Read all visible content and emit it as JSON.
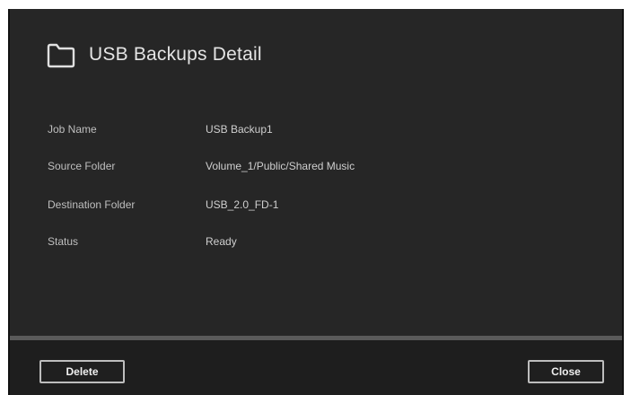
{
  "dialog": {
    "title": "USB Backups Detail",
    "icon": "folder-icon"
  },
  "details": [
    {
      "label": "Job Name",
      "value": "USB Backup1"
    },
    {
      "label": "Source Folder",
      "value": "Volume_1/Public/Shared Music"
    },
    {
      "label": "Destination Folder",
      "value": "USB_2.0_FD-1"
    },
    {
      "label": "Status",
      "value": "Ready"
    }
  ],
  "buttons": {
    "delete_label": "Delete",
    "close_label": "Close"
  },
  "colors": {
    "dialog_background": "#262626",
    "footer_background": "#1e1e1e",
    "divider": "#5a5a5a",
    "button_border": "#bdbdbd"
  }
}
